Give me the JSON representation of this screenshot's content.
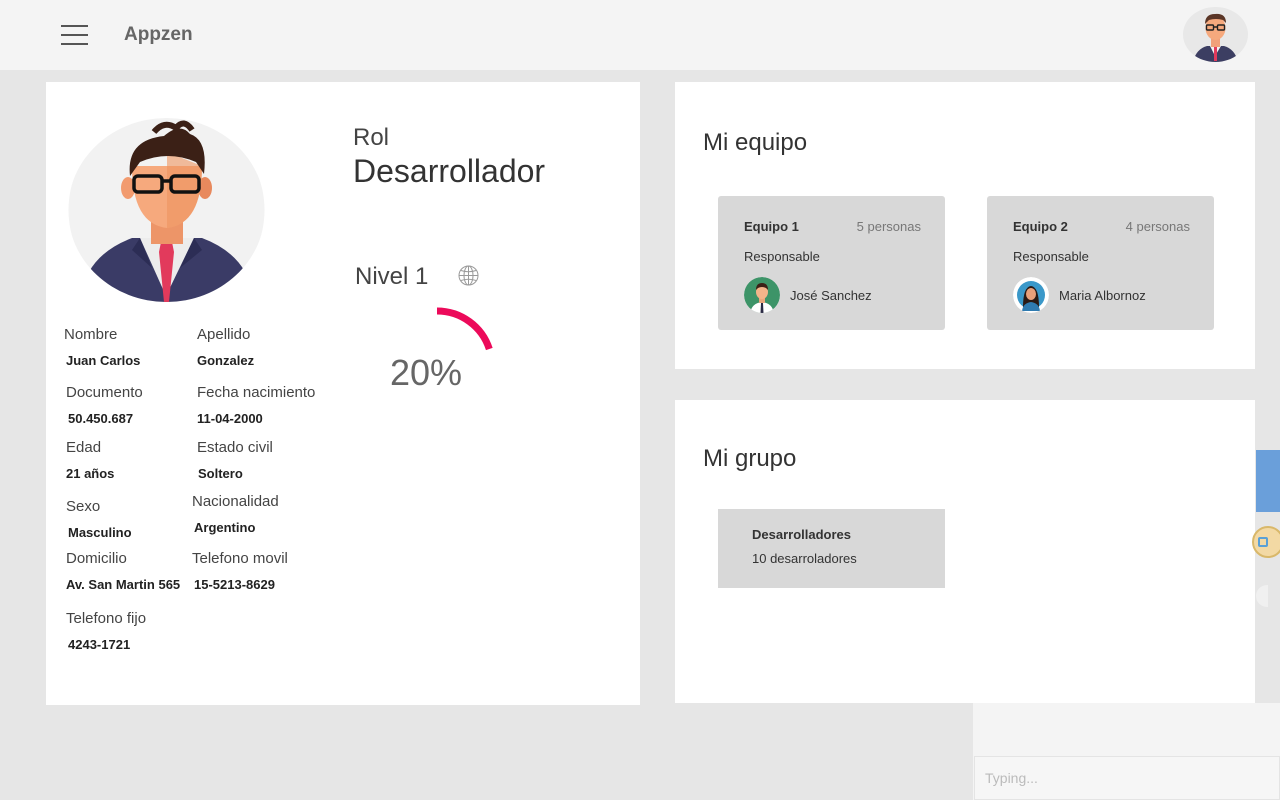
{
  "header": {
    "app_name": "Appzen",
    "menu_icon": "hamburger-menu-icon",
    "avatar_icon": "user-avatar-icon"
  },
  "profile": {
    "fields": {
      "nombre": {
        "label": "Nombre",
        "value": "Juan Carlos"
      },
      "apellido": {
        "label": "Apellido",
        "value": "Gonzalez"
      },
      "documento": {
        "label": "Documento",
        "value": "50.450.687"
      },
      "fecha_nacimiento": {
        "label": "Fecha nacimiento",
        "value": "11-04-2000"
      },
      "edad": {
        "label": "Edad",
        "value": "21 años"
      },
      "estado_civil": {
        "label": "Estado civil",
        "value": "Soltero"
      },
      "sexo": {
        "label": "Sexo",
        "value": "Masculino"
      },
      "nacionalidad": {
        "label": "Nacionalidad",
        "value": "Argentino"
      },
      "domicilio": {
        "label": "Domicilio",
        "value": "Av. San Martin 565"
      },
      "telefono_movil": {
        "label": "Telefono movil",
        "value": "15-5213-8629"
      },
      "telefono_fijo": {
        "label": "Telefono fijo",
        "value": "4243-1721"
      }
    },
    "rol": {
      "label": "Rol",
      "value": "Desarrollador"
    },
    "nivel": {
      "label": "Nivel 1",
      "progress_text": "20%",
      "progress_fraction": 0.2,
      "accent_color": "#ec0a5a",
      "icon": "globe-icon"
    }
  },
  "team": {
    "title": "Mi equipo",
    "teams": [
      {
        "name": "Equipo 1",
        "count": "5 personas",
        "role": "Responsable",
        "member": "José Sanchez"
      },
      {
        "name": "Equipo 2",
        "count": "4 personas",
        "role": "Responsable",
        "member": "Maria Albornoz"
      }
    ]
  },
  "group": {
    "title": "Mi grupo",
    "groups": [
      {
        "name": "Desarrolladores",
        "count": "10 desarroladores"
      }
    ]
  },
  "chat": {
    "placeholder": "Typing..."
  }
}
